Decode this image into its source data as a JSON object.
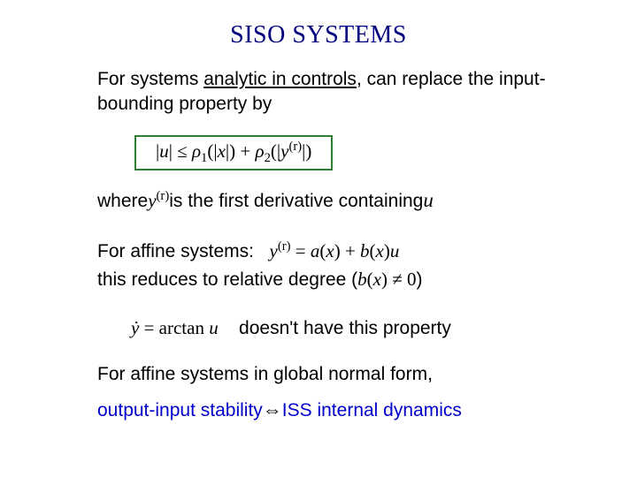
{
  "title": "SISO  SYSTEMS",
  "p1_a": "For systems ",
  "p1_b": "analytic in controls",
  "p1_c": ", can replace the input-bounding property by",
  "boxed_eq": "|u| ≤ ρ",
  "boxed_sub1": "1",
  "boxed_mid1": "(|x|) + ρ",
  "boxed_sub2": "2",
  "boxed_mid2": "(|y",
  "boxed_sup_r": "(r)",
  "boxed_end": "|)",
  "where_a": "where ",
  "where_expr_base": "y",
  "where_expr_sup": "(r)",
  "where_b": " is the first derivative containing ",
  "where_u": "u",
  "aff_a": "For affine systems:   ",
  "aff_eq_lhs_base": "y",
  "aff_eq_lhs_sup": "(r)",
  "aff_eq_eq": " = ",
  "aff_eq_rhs_a": "a",
  "aff_eq_rhs_x": "(x) + ",
  "aff_eq_rhs_b": "b",
  "aff_eq_rhs_xu": "(x)u",
  "aff_line2_a": "this reduces to relative degree (",
  "aff_line2_b_b": "b",
  "aff_line2_b_rest": "(x) ≠ 0",
  "aff_line2_c": ")",
  "ydot_lhs": "ẏ = ",
  "ydot_arctan": "arctan ",
  "ydot_u": "u",
  "ydot_text": "    doesn't have this property",
  "p_last_a": "For affine systems in global normal form,",
  "p_last_b1": "output-input stability ",
  "p_last_arrow": "⇔",
  "p_last_b2": " ISS internal dynamics"
}
